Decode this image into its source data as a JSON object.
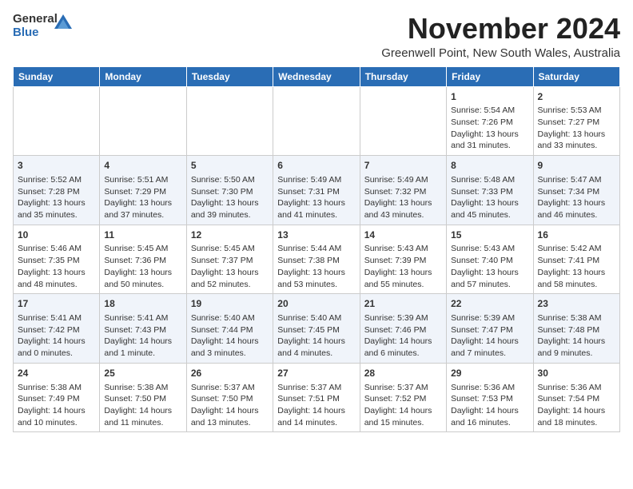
{
  "header": {
    "logo_general": "General",
    "logo_blue": "Blue",
    "month_title": "November 2024",
    "subtitle": "Greenwell Point, New South Wales, Australia"
  },
  "days_of_week": [
    "Sunday",
    "Monday",
    "Tuesday",
    "Wednesday",
    "Thursday",
    "Friday",
    "Saturday"
  ],
  "weeks": [
    [
      {
        "day": "",
        "info": ""
      },
      {
        "day": "",
        "info": ""
      },
      {
        "day": "",
        "info": ""
      },
      {
        "day": "",
        "info": ""
      },
      {
        "day": "",
        "info": ""
      },
      {
        "day": "1",
        "info": "Sunrise: 5:54 AM\nSunset: 7:26 PM\nDaylight: 13 hours and 31 minutes."
      },
      {
        "day": "2",
        "info": "Sunrise: 5:53 AM\nSunset: 7:27 PM\nDaylight: 13 hours and 33 minutes."
      }
    ],
    [
      {
        "day": "3",
        "info": "Sunrise: 5:52 AM\nSunset: 7:28 PM\nDaylight: 13 hours and 35 minutes."
      },
      {
        "day": "4",
        "info": "Sunrise: 5:51 AM\nSunset: 7:29 PM\nDaylight: 13 hours and 37 minutes."
      },
      {
        "day": "5",
        "info": "Sunrise: 5:50 AM\nSunset: 7:30 PM\nDaylight: 13 hours and 39 minutes."
      },
      {
        "day": "6",
        "info": "Sunrise: 5:49 AM\nSunset: 7:31 PM\nDaylight: 13 hours and 41 minutes."
      },
      {
        "day": "7",
        "info": "Sunrise: 5:49 AM\nSunset: 7:32 PM\nDaylight: 13 hours and 43 minutes."
      },
      {
        "day": "8",
        "info": "Sunrise: 5:48 AM\nSunset: 7:33 PM\nDaylight: 13 hours and 45 minutes."
      },
      {
        "day": "9",
        "info": "Sunrise: 5:47 AM\nSunset: 7:34 PM\nDaylight: 13 hours and 46 minutes."
      }
    ],
    [
      {
        "day": "10",
        "info": "Sunrise: 5:46 AM\nSunset: 7:35 PM\nDaylight: 13 hours and 48 minutes."
      },
      {
        "day": "11",
        "info": "Sunrise: 5:45 AM\nSunset: 7:36 PM\nDaylight: 13 hours and 50 minutes."
      },
      {
        "day": "12",
        "info": "Sunrise: 5:45 AM\nSunset: 7:37 PM\nDaylight: 13 hours and 52 minutes."
      },
      {
        "day": "13",
        "info": "Sunrise: 5:44 AM\nSunset: 7:38 PM\nDaylight: 13 hours and 53 minutes."
      },
      {
        "day": "14",
        "info": "Sunrise: 5:43 AM\nSunset: 7:39 PM\nDaylight: 13 hours and 55 minutes."
      },
      {
        "day": "15",
        "info": "Sunrise: 5:43 AM\nSunset: 7:40 PM\nDaylight: 13 hours and 57 minutes."
      },
      {
        "day": "16",
        "info": "Sunrise: 5:42 AM\nSunset: 7:41 PM\nDaylight: 13 hours and 58 minutes."
      }
    ],
    [
      {
        "day": "17",
        "info": "Sunrise: 5:41 AM\nSunset: 7:42 PM\nDaylight: 14 hours and 0 minutes."
      },
      {
        "day": "18",
        "info": "Sunrise: 5:41 AM\nSunset: 7:43 PM\nDaylight: 14 hours and 1 minute."
      },
      {
        "day": "19",
        "info": "Sunrise: 5:40 AM\nSunset: 7:44 PM\nDaylight: 14 hours and 3 minutes."
      },
      {
        "day": "20",
        "info": "Sunrise: 5:40 AM\nSunset: 7:45 PM\nDaylight: 14 hours and 4 minutes."
      },
      {
        "day": "21",
        "info": "Sunrise: 5:39 AM\nSunset: 7:46 PM\nDaylight: 14 hours and 6 minutes."
      },
      {
        "day": "22",
        "info": "Sunrise: 5:39 AM\nSunset: 7:47 PM\nDaylight: 14 hours and 7 minutes."
      },
      {
        "day": "23",
        "info": "Sunrise: 5:38 AM\nSunset: 7:48 PM\nDaylight: 14 hours and 9 minutes."
      }
    ],
    [
      {
        "day": "24",
        "info": "Sunrise: 5:38 AM\nSunset: 7:49 PM\nDaylight: 14 hours and 10 minutes."
      },
      {
        "day": "25",
        "info": "Sunrise: 5:38 AM\nSunset: 7:50 PM\nDaylight: 14 hours and 11 minutes."
      },
      {
        "day": "26",
        "info": "Sunrise: 5:37 AM\nSunset: 7:50 PM\nDaylight: 14 hours and 13 minutes."
      },
      {
        "day": "27",
        "info": "Sunrise: 5:37 AM\nSunset: 7:51 PM\nDaylight: 14 hours and 14 minutes."
      },
      {
        "day": "28",
        "info": "Sunrise: 5:37 AM\nSunset: 7:52 PM\nDaylight: 14 hours and 15 minutes."
      },
      {
        "day": "29",
        "info": "Sunrise: 5:36 AM\nSunset: 7:53 PM\nDaylight: 14 hours and 16 minutes."
      },
      {
        "day": "30",
        "info": "Sunrise: 5:36 AM\nSunset: 7:54 PM\nDaylight: 14 hours and 18 minutes."
      }
    ]
  ]
}
